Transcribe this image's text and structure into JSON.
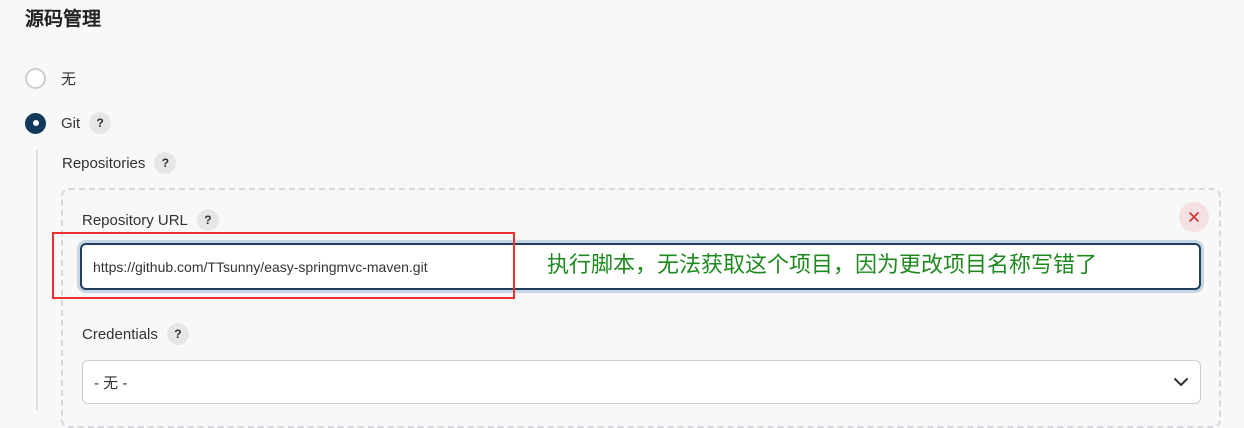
{
  "section": {
    "title": "源码管理"
  },
  "scm_options": [
    {
      "label": "无",
      "selected": false
    },
    {
      "label": "Git",
      "selected": true
    }
  ],
  "help_glyph": "?",
  "git": {
    "repositories_label": "Repositories",
    "repository_url_label": "Repository URL",
    "repository_url_value": "https://github.com/TTsunny/easy-springmvc-maven.git",
    "credentials_label": "Credentials",
    "credentials_selected": "- 无 -"
  },
  "annotation": {
    "text": "执行脚本，无法获取这个项目，因为更改项目名称写错了",
    "color": "#1f8a1f",
    "box_color": "#e8322d"
  },
  "icons": {
    "delete": "close-icon",
    "dropdown": "chevron-down-icon",
    "help": "help-icon"
  },
  "colors": {
    "accent": "#12395c",
    "delete_bg": "#f5e1e1",
    "delete_fg": "#d0332f"
  }
}
